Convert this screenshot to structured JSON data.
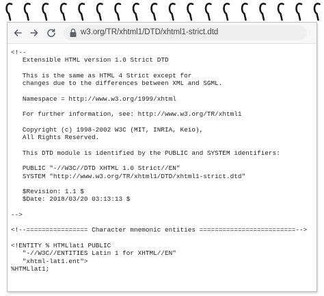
{
  "browser": {
    "url": "w3.org/TR/xhtml1/DTD/xhtml1-strict.dtd",
    "icons": {
      "back": "arrow-left-icon",
      "forward": "arrow-right-icon",
      "reload": "reload-icon",
      "security": "lock-icon"
    }
  },
  "document": {
    "lines": [
      "<!--",
      "   Extensible HTML version 1.0 Strict DTD",
      "",
      "   This is the same as HTML 4 Strict except for",
      "   changes due to the differences between XML and SGML.",
      "",
      "   Namespace = http://www.w3.org/1999/xhtml",
      "",
      "   For further information, see: http://www.w3.org/TR/xhtml1",
      "",
      "   Copyright (c) 1998-2002 W3C (MIT, INRIA, Keio),",
      "   All Rights Reserved.",
      "",
      "   This DTD module is identified by the PUBLIC and SYSTEM identifiers:",
      "",
      "   PUBLIC \"-//W3C//DTD XHTML 1.0 Strict//EN\"",
      "   SYSTEM \"http://www.w3.org/TR/xhtml1/DTD/xhtml1-strict.dtd\"",
      "",
      "   $Revision: 1.1 $",
      "   $Date: 2018/03/20 03:13:13 $",
      "",
      "-->",
      "",
      "<!--================ Character mnemonic entities =========================-->",
      "",
      "<!ENTITY % HTMLlat1 PUBLIC",
      "   \"-//W3C//ENTITIES Latin 1 for XHTML//EN\"",
      "   \"xhtml-lat1.ent\">",
      "%HTMLlat1;"
    ]
  },
  "colors": {
    "browser_bar": "#f7f7f7",
    "url_box": "#efefef",
    "text": "#222222",
    "icon": "#5f6368",
    "disabled_icon": "#b5b5b5"
  }
}
